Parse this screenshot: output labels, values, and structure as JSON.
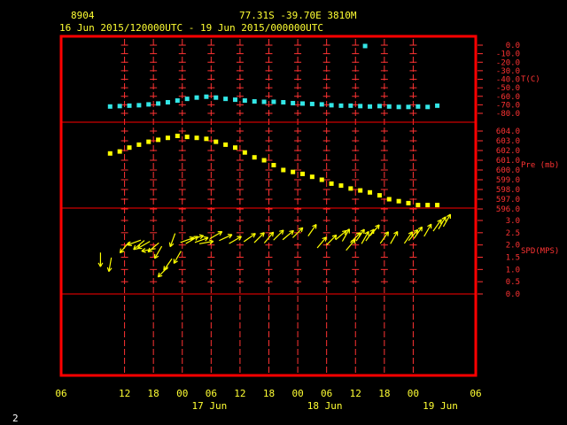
{
  "header": {
    "station": "8904",
    "location": "77.31S   -39.70E   3810M",
    "period": "16 Jun 2015/120000UTC - 19 Jun 2015/000000UTC"
  },
  "corner_label": "2",
  "colors": {
    "frame": "#ff0000",
    "grid": "#ff3333",
    "temp": "#33e6e6",
    "pres": "#ffff00",
    "wind": "#ffff00",
    "text": "#ffff33"
  },
  "chart_data": [
    {
      "type": "scatter",
      "ylabel": "T(C)",
      "ylim": [
        -80,
        0
      ],
      "y_ticks": [
        "0.0",
        "-10.0",
        "-20.0",
        "-30.0",
        "-40.0",
        "-50.0",
        "-60.0",
        "-70.0",
        "-80.0"
      ],
      "y_tick_values": [
        0,
        -10,
        -20,
        -30,
        -40,
        -50,
        -60,
        -70,
        -80
      ],
      "x_hours": [
        3,
        5,
        7,
        9,
        11,
        13,
        15,
        17,
        19,
        21,
        23,
        25,
        27,
        29,
        31,
        33,
        35,
        37,
        39,
        41,
        43,
        45,
        47,
        49,
        51,
        53,
        55,
        57,
        59,
        61,
        63,
        65,
        67,
        69,
        71
      ],
      "values": [
        -72,
        -71.5,
        -71,
        -70.5,
        -69.5,
        -68.5,
        -67,
        -65,
        -63,
        -61.5,
        -60.5,
        -61.5,
        -63,
        -64,
        -65,
        -66,
        -66.5,
        -66.5,
        -67,
        -68,
        -68.5,
        -69,
        -69.5,
        -70.5,
        -71,
        -71,
        -71.5,
        -72,
        -71.5,
        -72,
        -72.5,
        -72.5,
        -72,
        -72.5,
        -71
      ],
      "extra_points": [
        {
          "x": 56,
          "y": -1
        }
      ]
    },
    {
      "type": "scatter",
      "ylabel": "Pre (mb)",
      "ylim": [
        596,
        604
      ],
      "y_ticks": [
        "604.0",
        "603.0",
        "602.0",
        "601.0",
        "600.0",
        "599.0",
        "598.0",
        "597.0",
        "596.0"
      ],
      "y_tick_values": [
        604,
        603,
        602,
        601,
        600,
        599,
        598,
        597,
        596
      ],
      "x_hours": [
        3,
        5,
        7,
        9,
        11,
        13,
        15,
        17,
        19,
        21,
        23,
        25,
        27,
        29,
        31,
        33,
        35,
        37,
        39,
        41,
        43,
        45,
        47,
        49,
        51,
        53,
        55,
        57,
        59,
        61,
        63,
        65,
        67,
        69,
        71
      ],
      "values": [
        601.7,
        601.9,
        602.3,
        602.6,
        602.9,
        603.1,
        603.3,
        603.5,
        603.4,
        603.3,
        603.2,
        602.9,
        602.6,
        602.3,
        601.8,
        601.3,
        601.0,
        600.5,
        600.0,
        599.8,
        599.6,
        599.3,
        599.0,
        598.6,
        598.4,
        598.1,
        597.9,
        597.7,
        597.4,
        597.0,
        596.8,
        596.6,
        596.4,
        596.4,
        596.4
      ]
    },
    {
      "type": "scatter",
      "ylabel": "SPD(MPS)",
      "ylim": [
        0,
        3
      ],
      "y_ticks": [
        "3.0",
        "2.5",
        "2.0",
        "1.5",
        "1.0",
        "0.5",
        "0.0"
      ],
      "y_tick_values": [
        3,
        2.5,
        2,
        1.5,
        1,
        0.5,
        0
      ],
      "x_hours": [
        1,
        3,
        6,
        8,
        9,
        10,
        11,
        12,
        13,
        14,
        15,
        16,
        17,
        19,
        20,
        21,
        22,
        23,
        25,
        27,
        29,
        32,
        34,
        36,
        38,
        40,
        42,
        45,
        47,
        49,
        51,
        52,
        53,
        54,
        55,
        56,
        57,
        58,
        60,
        62,
        65,
        66,
        67,
        69,
        71,
        72,
        73
      ],
      "values": [
        1.4,
        1.2,
        1.9,
        2.1,
        2.0,
        2.0,
        1.8,
        1.9,
        1.7,
        0.9,
        1.2,
        2.2,
        1.5,
        2.2,
        2.2,
        2.3,
        2.2,
        2.1,
        2.4,
        2.3,
        2.2,
        2.3,
        2.3,
        2.3,
        2.4,
        2.4,
        2.5,
        2.6,
        2.1,
        2.2,
        2.4,
        2.4,
        2.0,
        2.3,
        2.4,
        2.3,
        2.4,
        2.6,
        2.3,
        2.3,
        2.3,
        2.4,
        2.5,
        2.6,
        2.8,
        2.9,
        3.0
      ],
      "directions_deg": [
        180,
        190,
        220,
        250,
        230,
        240,
        260,
        230,
        210,
        225,
        215,
        200,
        210,
        70,
        60,
        75,
        70,
        80,
        60,
        65,
        60,
        55,
        45,
        40,
        45,
        50,
        45,
        35,
        40,
        45,
        50,
        30,
        40,
        45,
        35,
        30,
        35,
        40,
        35,
        30,
        35,
        40,
        35,
        30,
        35,
        30,
        30
      ]
    }
  ],
  "x_axis": {
    "tick_hours": [
      0,
      6,
      12,
      18,
      24,
      30,
      36,
      42,
      48,
      54,
      60,
      66,
      72
    ],
    "tick_labels": [
      "06",
      "12",
      "18",
      "00",
      "06",
      "12",
      "18",
      "00",
      "06",
      "12",
      "18",
      "00",
      "06"
    ],
    "day_labels": [
      {
        "hour": 24,
        "text": "17 Jun"
      },
      {
        "hour": 48,
        "text": "18 Jun"
      },
      {
        "hour": 72,
        "text": "19 Jun"
      }
    ]
  }
}
